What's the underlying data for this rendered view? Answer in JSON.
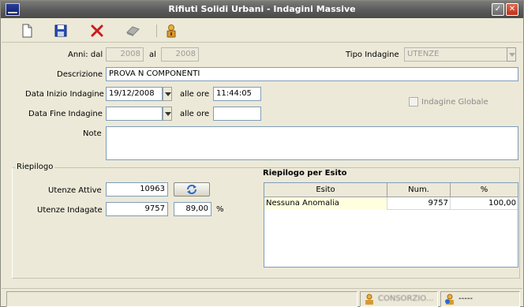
{
  "window": {
    "title": "Rifiuti Solidi Urbani - Indagini Massive",
    "minimize_glyph": "✓",
    "close_glyph": "✕"
  },
  "toolbar": {
    "items": [
      {
        "name": "new-document-icon"
      },
      {
        "name": "save-icon"
      },
      {
        "name": "delete-icon"
      },
      {
        "name": "eraser-icon"
      },
      {
        "name": "user-lock-icon"
      }
    ]
  },
  "form": {
    "anni_label": "Anni: dal",
    "anni_dal": "2008",
    "anni_al_label": "al",
    "anni_al": "2008",
    "tipo_indagine_label": "Tipo Indagine",
    "tipo_indagine_value": "UTENZE",
    "descrizione_label": "Descrizione",
    "descrizione_value": "PROVA N COMPONENTI",
    "data_inizio_label": "Data Inizio Indagine",
    "data_inizio_value": "19/12/2008",
    "ore_label": "alle ore",
    "ora_inizio_value": "11:44:05",
    "data_fine_label": "Data Fine Indagine",
    "data_fine_value": "",
    "ora_fine_value": "",
    "indagine_globale_label": "Indagine Globale",
    "note_label": "Note",
    "note_value": ""
  },
  "riepilogo": {
    "legend": "Riepilogo",
    "utenze_attive_label": "Utenze Attive",
    "utenze_attive_value": "10963",
    "utenze_indagate_label": "Utenze Indagate",
    "utenze_indagate_value": "9757",
    "percentuale_value": "89,00",
    "percent_sign": "%"
  },
  "esito": {
    "title": "Riepilogo per Esito",
    "columns": [
      "Esito",
      "Num.",
      "%"
    ],
    "rows": [
      {
        "esito": "Nessuna Anomalia",
        "num": "9757",
        "perc": "100,00"
      }
    ]
  },
  "statusbar": {
    "user": "CONSORZIO...",
    "info": "-----"
  },
  "colors": {
    "window_bg": "#ece9d8",
    "titlebar": "#5c5c5c",
    "close_button": "#c0301a"
  }
}
